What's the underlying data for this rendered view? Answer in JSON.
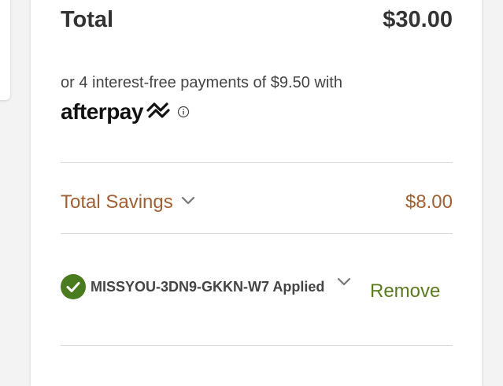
{
  "total": {
    "label": "Total",
    "amount": "$30.00"
  },
  "afterpay": {
    "installments_text": "or 4 interest-free payments of $9.50 with",
    "brand": "afterpay",
    "logo_icon": "afterpay-arrows-icon",
    "info_icon": "info-icon"
  },
  "savings": {
    "label": "Total Savings",
    "amount": "$8.00",
    "chevron_icon": "chevron-down-icon"
  },
  "promo": {
    "status_icon": "check-circle-icon",
    "code_text": "MISSYOU-3DN9-GKKN-W7 Applied",
    "chevron_icon": "chevron-down-icon",
    "remove_label": "Remove"
  },
  "colors": {
    "savings": "#a06033",
    "success_green": "#4a7c1f",
    "remove": "#5a7a1e",
    "text": "#333333"
  }
}
